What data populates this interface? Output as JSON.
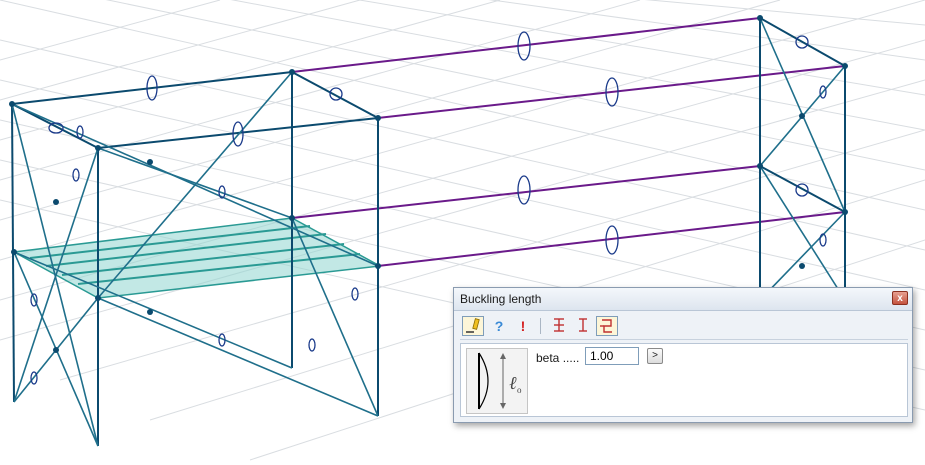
{
  "viewport": {
    "description_icon": "structural-frame-3d-view"
  },
  "dialog": {
    "title": "Buckling length",
    "toolbar": [
      {
        "name": "edit-icon"
      },
      {
        "name": "help-icon",
        "glyph": "?"
      },
      {
        "name": "warning-icon",
        "glyph": "!"
      },
      {
        "name": "buckling-both-ends-icon"
      },
      {
        "name": "buckling-pinned-icon"
      },
      {
        "name": "buckling-special-icon"
      }
    ],
    "beta_label": "beta .....",
    "beta_value": "1.00",
    "beta_button": ">",
    "close_glyph": "x"
  },
  "colors": {
    "member": "#0b4a6e",
    "brace": "#1f6f8b",
    "purple": "#6a1a8a",
    "slab": "#3aa6a0",
    "grid": "#d5d9dd"
  }
}
